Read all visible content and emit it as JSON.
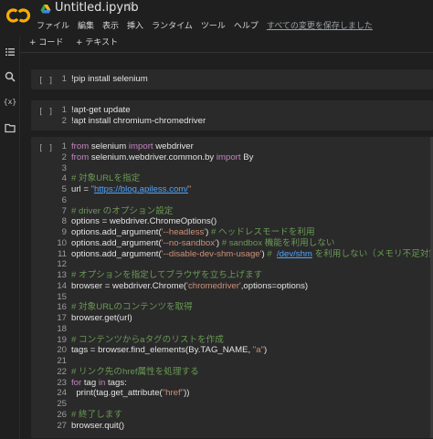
{
  "app": {
    "title": "Untitled.ipynb",
    "star": "☆",
    "menu": [
      "ファイル",
      "編集",
      "表示",
      "挿入",
      "ランタイム",
      "ツール",
      "ヘルプ"
    ],
    "save_status": "すべての変更を保存しました"
  },
  "toolbar": {
    "code_label": "+ コード",
    "text_label": "+ テキスト"
  },
  "sidebar": {
    "icons": [
      "toc-icon",
      "search-icon",
      "variables-icon",
      "folder-icon"
    ]
  },
  "colors": {
    "logo_orange": "#f9ab00",
    "keyword": "#c586c0",
    "string": "#ce9178",
    "comment": "#6a9955",
    "link": "#4fa5ff"
  },
  "cells": [
    {
      "run": "[ ]",
      "lines": [
        [
          [
            "",
            "!pip install selenium"
          ]
        ]
      ]
    },
    {
      "run": "[ ]",
      "lines": [
        [
          [
            "",
            "!apt-get update"
          ]
        ],
        [
          [
            "",
            "!apt install chromium-chromedriver"
          ]
        ]
      ]
    },
    {
      "run": "[ ]",
      "lines": [
        [
          [
            "kw",
            "from"
          ],
          [
            "",
            " selenium "
          ],
          [
            "kw",
            "import"
          ],
          [
            "",
            " webdriver"
          ]
        ],
        [
          [
            "kw",
            "from"
          ],
          [
            "",
            " selenium.webdriver.common.by "
          ],
          [
            "kw",
            "import"
          ],
          [
            "",
            " By"
          ]
        ],
        [],
        [
          [
            "cm",
            "# 対象URLを指定"
          ]
        ],
        [
          [
            "",
            "url = "
          ],
          [
            "str",
            "\""
          ],
          [
            "link",
            "https://blog.apiless.com/"
          ],
          [
            "str",
            "\""
          ]
        ],
        [],
        [
          [
            "cm",
            "# driver のオプション設定"
          ]
        ],
        [
          [
            "",
            "options = webdriver.ChromeOptions()"
          ]
        ],
        [
          [
            "",
            "options.add_argument("
          ],
          [
            "str",
            "'--headless'"
          ],
          [
            "",
            ") "
          ],
          [
            "cm",
            "# ヘッドレスモードを利用"
          ]
        ],
        [
          [
            "",
            "options.add_argument("
          ],
          [
            "str",
            "'--no-sandbox'"
          ],
          [
            "",
            ") "
          ],
          [
            "cm",
            "# sandbox 機能を利用しない"
          ]
        ],
        [
          [
            "",
            "options.add_argument("
          ],
          [
            "str",
            "'--disable-dev-shm-usage'"
          ],
          [
            "",
            ") "
          ],
          [
            "cm",
            "#  "
          ],
          [
            "link",
            "/dev/shm"
          ],
          [
            "cm",
            " を利用しない（メモリ不足対策）"
          ]
        ],
        [],
        [
          [
            "cm",
            "# オプションを指定してブラウザを立ち上げます"
          ]
        ],
        [
          [
            "",
            "browser = webdriver.Chrome("
          ],
          [
            "str",
            "'chromedriver'"
          ],
          [
            "",
            ",options=options)"
          ]
        ],
        [],
        [
          [
            "cm",
            "# 対象URLのコンテンツを取得"
          ]
        ],
        [
          [
            "",
            "browser.get(url)"
          ]
        ],
        [],
        [
          [
            "cm",
            "# コンテンツからaタグのリストを作成"
          ]
        ],
        [
          [
            "",
            "tags = browser.find_elements(By.TAG_NAME, "
          ],
          [
            "str",
            "\"a\""
          ],
          [
            "",
            ")"
          ]
        ],
        [],
        [
          [
            "cm",
            "# リンク先のhref属性を処理する"
          ]
        ],
        [
          [
            "kw",
            "for"
          ],
          [
            "",
            " tag "
          ],
          [
            "kw",
            "in"
          ],
          [
            "",
            " tags:"
          ]
        ],
        [
          [
            "",
            "  print(tag.get_attribute("
          ],
          [
            "str",
            "\"href\""
          ],
          [
            "",
            "))"
          ]
        ],
        [],
        [
          [
            "cm",
            "# 終了します"
          ]
        ],
        [
          [
            "",
            "browser.quit()"
          ]
        ]
      ]
    }
  ]
}
